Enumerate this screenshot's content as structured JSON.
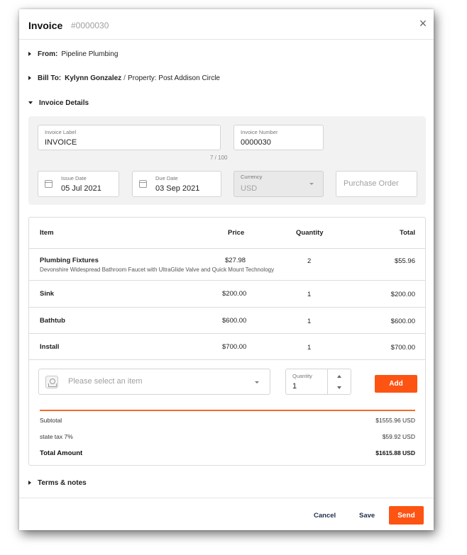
{
  "header": {
    "title": "Invoice",
    "number": "#0000030",
    "close_icon": "close-icon"
  },
  "sections": {
    "from": {
      "label": "From:",
      "value": "Pipeline Plumbing"
    },
    "bill_to": {
      "label": "Bill To:",
      "name": "Kylynn Gonzalez",
      "separator": "/",
      "property": "Property: Post Addison Circle"
    },
    "invoice_details": {
      "label": "Invoice Details"
    },
    "terms": {
      "label": "Terms & notes"
    }
  },
  "details": {
    "invoice_label": {
      "label": "Invoice Label",
      "value": "INVOICE",
      "counter": "7 / 100"
    },
    "invoice_number": {
      "label": "Invoice Number",
      "value": "0000030"
    },
    "issue_date": {
      "label": "Issue Date",
      "value": "05 Jul 2021"
    },
    "due_date": {
      "label": "Due Date",
      "value": "03 Sep 2021"
    },
    "currency": {
      "label": "Currency",
      "value": "USD"
    },
    "purchase_order": {
      "placeholder": "Purchase Order"
    }
  },
  "table": {
    "headers": {
      "item": "Item",
      "price": "Price",
      "quantity": "Quantity",
      "total": "Total"
    },
    "rows": [
      {
        "item": "Plumbing Fixtures",
        "description": "Devonshire Widespread Bathroom Faucet with UltraGlide Valve and Quick Mount Technology",
        "price": "$27.98",
        "quantity": "2",
        "total": "$55.96"
      },
      {
        "item": "Sink",
        "price": "$200.00",
        "quantity": "1",
        "total": "$200.00"
      },
      {
        "item": "Bathtub",
        "price": "$600.00",
        "quantity": "1",
        "total": "$600.00"
      },
      {
        "item": "Install",
        "price": "$700.00",
        "quantity": "1",
        "total": "$700.00"
      }
    ]
  },
  "add_item": {
    "placeholder": "Please select an item",
    "quantity_label": "Quantity",
    "quantity_value": "1",
    "add_label": "Add"
  },
  "totals": {
    "subtotal_label": "Subtotal",
    "subtotal_value": "$1555.96 USD",
    "tax_label": "state tax 7%",
    "tax_value": "$59.92 USD",
    "total_label": "Total Amount",
    "total_value": "$1615.88 USD"
  },
  "footer": {
    "cancel": "Cancel",
    "save": "Save",
    "send": "Send"
  },
  "colors": {
    "accent": "#fd5413",
    "divider_accent": "#f36b2c",
    "footer_link": "#1d2d4a"
  }
}
